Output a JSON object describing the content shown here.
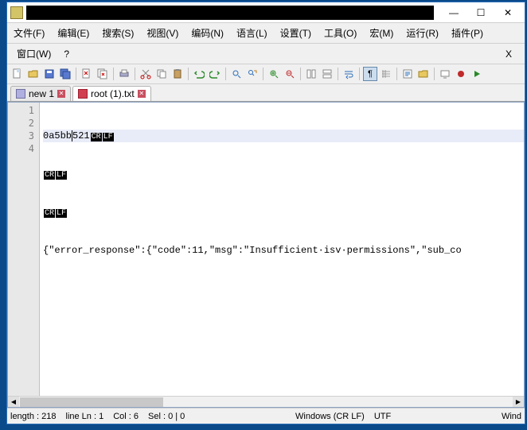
{
  "window": {
    "minimize": "—",
    "maximize": "☐",
    "close": "✕"
  },
  "menu": {
    "file": "文件(F)",
    "edit": "编辑(E)",
    "search": "搜索(S)",
    "view": "视图(V)",
    "encoding": "编码(N)",
    "language": "语言(L)",
    "settings": "设置(T)",
    "tools": "工具(O)",
    "macro": "宏(M)",
    "run": "运行(R)",
    "plugins": "插件(P)",
    "window": "窗口(W)",
    "help": "?",
    "x": "X"
  },
  "tabs": [
    {
      "label": "new 1",
      "active": false,
      "icon": "new"
    },
    {
      "label": "root (1).txt",
      "active": true,
      "icon": "saved"
    }
  ],
  "gutter": [
    "1",
    "2",
    "3",
    "4"
  ],
  "code": {
    "line1_a": "0a5bb",
    "line1_b": "521",
    "crlf_cr": "CR",
    "crlf_lf": "LF",
    "line4": "{\"error_response\":{\"code\":11,\"msg\":\"Insufficient·isv·permissions\",\"sub_co"
  },
  "status": {
    "length": "length : 218",
    "line": "line Ln : 1",
    "col": "Col : 6",
    "sel": "Sel : 0 | 0",
    "eol": "Windows (CR LF)",
    "enc": "UTF",
    "ins": "Wind"
  },
  "colors": {
    "accent": "#2a6db8",
    "highlight": "#e8ecf8"
  }
}
